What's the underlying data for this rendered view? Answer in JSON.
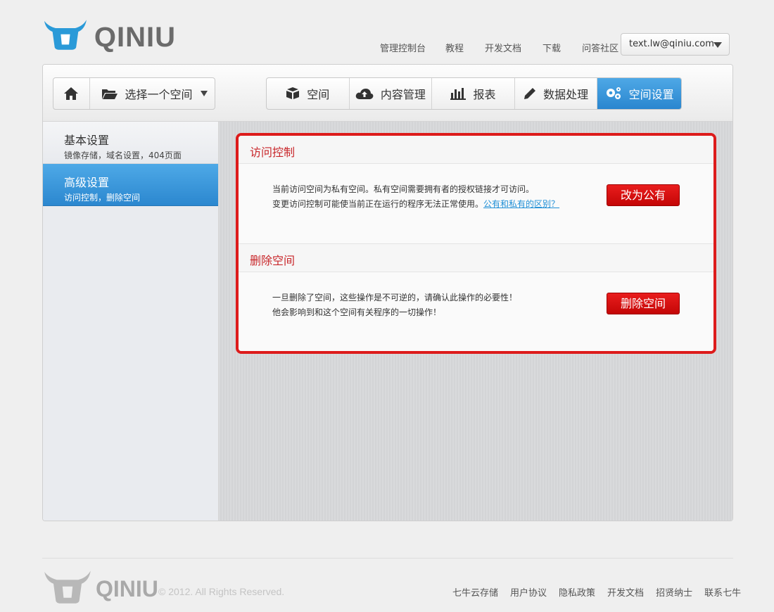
{
  "brand": {
    "name": "QINIU",
    "accent": "#2a86cf",
    "danger": "#dd1b1b"
  },
  "header": {
    "nav": [
      "管理控制台",
      "教程",
      "开发文档",
      "下载",
      "问答社区"
    ],
    "user": {
      "email": "text.lw@qiniu.com",
      "icon": "chevron-down-icon"
    }
  },
  "toolbar": {
    "home_icon": "home-icon",
    "bucket_select": {
      "label": "选择一个空间",
      "icon": "folder-icon"
    },
    "tabs": [
      {
        "label": "空间",
        "icon": "box-icon",
        "active": false
      },
      {
        "label": "内容管理",
        "icon": "cloud-upload-icon",
        "active": false
      },
      {
        "label": "报表",
        "icon": "bar-chart-icon",
        "active": false
      },
      {
        "label": "数据处理",
        "icon": "pencil-icon",
        "active": false
      },
      {
        "label": "空间设置",
        "icon": "gears-icon",
        "active": true
      }
    ]
  },
  "sidebar": {
    "items": [
      {
        "title": "基本设置",
        "subtitle": "镜像存储，域名设置，404页面",
        "active": false
      },
      {
        "title": "高级设置",
        "subtitle": "访问控制，删除空间",
        "active": true
      }
    ]
  },
  "access_control": {
    "title": "访问控制",
    "line1": "当前访问空间为私有空间。私有空间需要拥有者的授权链接才可访问。",
    "line2": "变更访问控制可能使当前正在运行的程序无法正常使用。",
    "link": "公有和私有的区别？",
    "button": "改为公有"
  },
  "delete_bucket": {
    "title": "删除空间",
    "line1": "一旦删除了空间，这些操作是不可逆的，请确认此操作的必要性！",
    "line2": "他会影响到和这个空间有关程序的一切操作！",
    "button": "删除空间"
  },
  "footer": {
    "copyright": "© 2012. All Rights Reserved.",
    "links": [
      "七牛云存储",
      "用户协议",
      "隐私政策",
      "开发文档",
      "招贤纳士",
      "联系七牛"
    ]
  }
}
